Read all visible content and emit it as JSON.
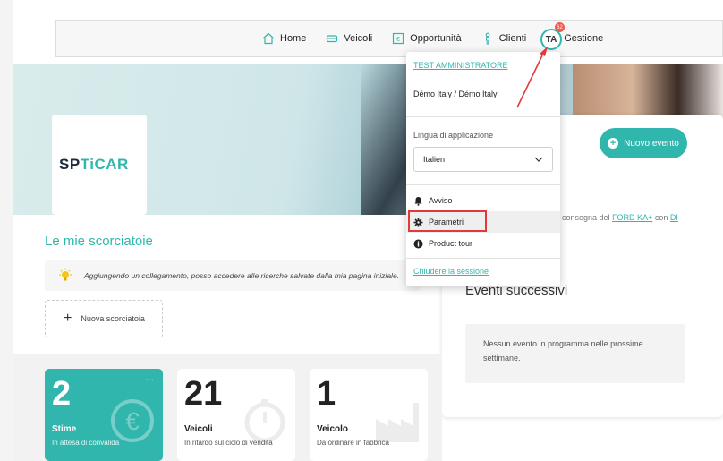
{
  "nav": {
    "items": [
      {
        "label": "Home",
        "icon": "home-icon"
      },
      {
        "label": "Veicoli",
        "icon": "car-icon"
      },
      {
        "label": "Opportunità",
        "icon": "opportunity-icon"
      },
      {
        "label": "Clienti",
        "icon": "person-icon"
      },
      {
        "label": "Gestione",
        "icon": "chart-icon"
      }
    ],
    "avatar_initials": "TA",
    "notification_count": "62"
  },
  "brand": {
    "logo_text_a": "SP",
    "logo_text_b": "TiCAR"
  },
  "dropdown": {
    "user_name": "TEST AMMINISTRATORE",
    "organization": "Démo Italy / Démo Italy",
    "language_label": "Lingua di applicazione",
    "language_value": "Italien",
    "menu_items": [
      {
        "label": "Avviso",
        "icon": "bell-icon"
      },
      {
        "label": "Parametri",
        "icon": "gear-icon"
      },
      {
        "label": "Product tour",
        "icon": "info-icon"
      }
    ],
    "logout_label": "Chiudere la sessione"
  },
  "events": {
    "new_event_label": "Nuovo evento",
    "delivery_text": "consegna del",
    "delivery_model": "FORD KA+",
    "delivery_with": "con",
    "delivery_trailing": "DI",
    "upcoming_title": "Eventi successivi",
    "empty_text": "Nessun evento in programma nelle prossime settimane."
  },
  "shortcuts": {
    "title": "Le mie scorciatoie",
    "hint": "Aggiungendo un collegamento, posso accedere alle ricerche salvate dalla mia pagina iniziale.",
    "new_label": "Nuova scorciatoia"
  },
  "stats": [
    {
      "number": "2",
      "label": "Stime",
      "sub": "In attesa di convalida",
      "more": "..."
    },
    {
      "number": "21",
      "label": "Veicoli",
      "sub": "In ritardo sul ciclo di vendita"
    },
    {
      "number": "1",
      "label": "Veicolo",
      "sub": "Da ordinare in fabbrica"
    }
  ],
  "colors": {
    "accent": "#31b6ad",
    "highlight": "#e23a3a",
    "brand_dark": "#1d2a39"
  }
}
